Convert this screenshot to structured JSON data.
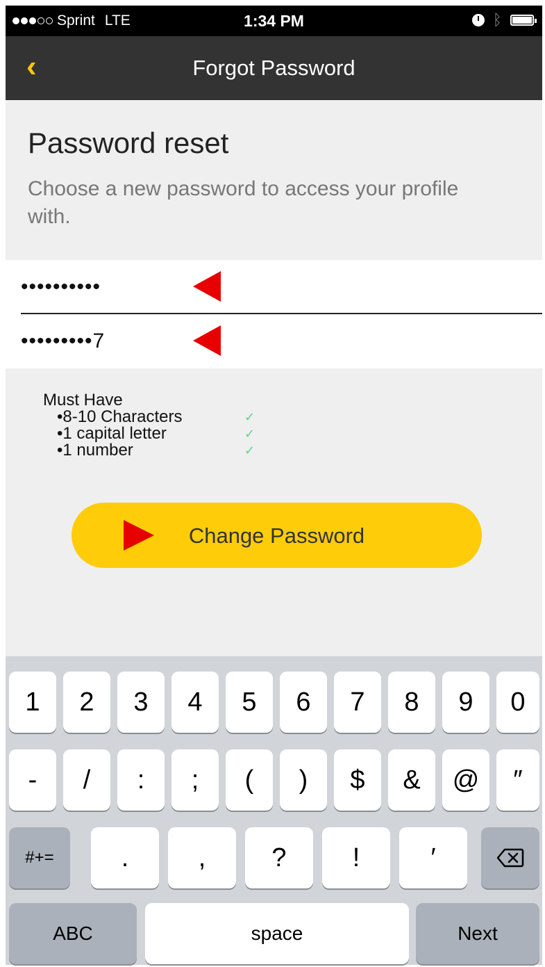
{
  "status_bar": {
    "carrier": "Sprint",
    "network": "LTE",
    "time": "1:34 PM"
  },
  "nav": {
    "back_icon": "chevron-left-icon",
    "title": "Forgot Password"
  },
  "reset": {
    "heading": "Password reset",
    "subtext": "Choose a new password to access your profile with.",
    "new_password_value": "••••••••••",
    "confirm_password_value": "•••••••••7"
  },
  "requirements": {
    "title": "Must Have",
    "items": [
      {
        "label": "•8-10 Characters",
        "met": true
      },
      {
        "label": "•1 capital letter",
        "met": true
      },
      {
        "label": "•1 number",
        "met": true
      }
    ]
  },
  "button": {
    "label": "Change Password"
  },
  "keyboard": {
    "row1": [
      "1",
      "2",
      "3",
      "4",
      "5",
      "6",
      "7",
      "8",
      "9",
      "0"
    ],
    "row2": [
      "-",
      "/",
      ":",
      ";",
      "(",
      ")",
      "$",
      "&",
      "@",
      "″"
    ],
    "row3_left": "#+=",
    "row3": [
      ".",
      ",",
      "?",
      "!",
      "′"
    ],
    "row3_right_icon": "backspace-icon",
    "row4": {
      "left": "ABC",
      "space": "space",
      "right": "Next"
    }
  },
  "colors": {
    "accent": "#ffcc0a",
    "navbar": "#333333",
    "annotation": "#e60000",
    "check": "#5fd38d"
  }
}
